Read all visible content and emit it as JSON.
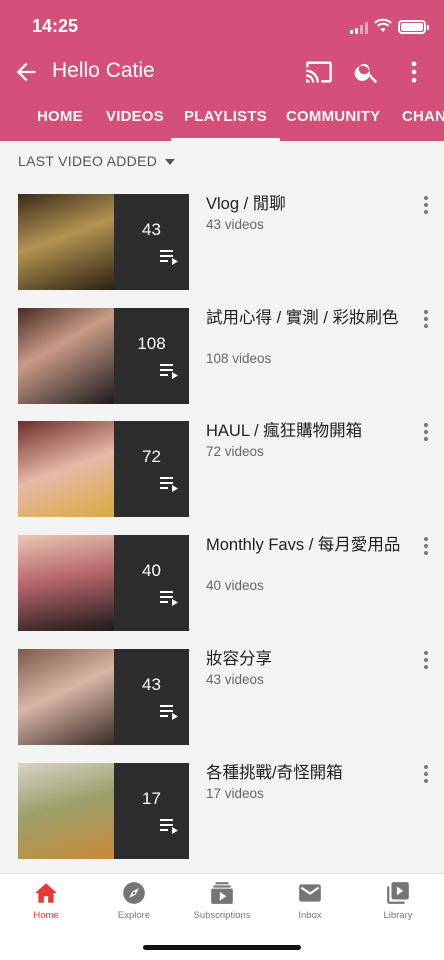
{
  "status": {
    "time": "14:25"
  },
  "header": {
    "title": "Hello Catie",
    "back_icon": "arrow-left-icon",
    "icons": [
      "cast-icon",
      "search-icon",
      "more-vert-icon"
    ],
    "brand_color": "#d4507a"
  },
  "tabs": [
    {
      "label": "HOME"
    },
    {
      "label": "VIDEOS"
    },
    {
      "label": "PLAYLISTS",
      "active": true
    },
    {
      "label": "COMMUNITY"
    },
    {
      "label": "CHAN"
    }
  ],
  "sort": {
    "label": "LAST VIDEO ADDED"
  },
  "playlists": [
    {
      "count": "43",
      "title": "Vlog / 閒聊",
      "meta": "43 videos"
    },
    {
      "count": "108",
      "title": "試用心得 / 實測 / 彩妝刷色",
      "meta": "108 videos"
    },
    {
      "count": "72",
      "title": "HAUL / 瘋狂購物開箱",
      "meta": "72 videos"
    },
    {
      "count": "40",
      "title": "Monthly Favs / 每月愛用品",
      "meta": "40 videos"
    },
    {
      "count": "43",
      "title": "妝容分享",
      "meta": "43 videos"
    },
    {
      "count": "17",
      "title": "各種挑戰/奇怪開箱",
      "meta": "17 videos"
    }
  ],
  "bottom_nav": [
    {
      "label": "Home",
      "icon": "home-icon",
      "active": true
    },
    {
      "label": "Explore",
      "icon": "compass-icon"
    },
    {
      "label": "Subscriptions",
      "icon": "subscriptions-icon"
    },
    {
      "label": "Inbox",
      "icon": "mail-icon"
    },
    {
      "label": "Library",
      "icon": "library-icon"
    }
  ]
}
